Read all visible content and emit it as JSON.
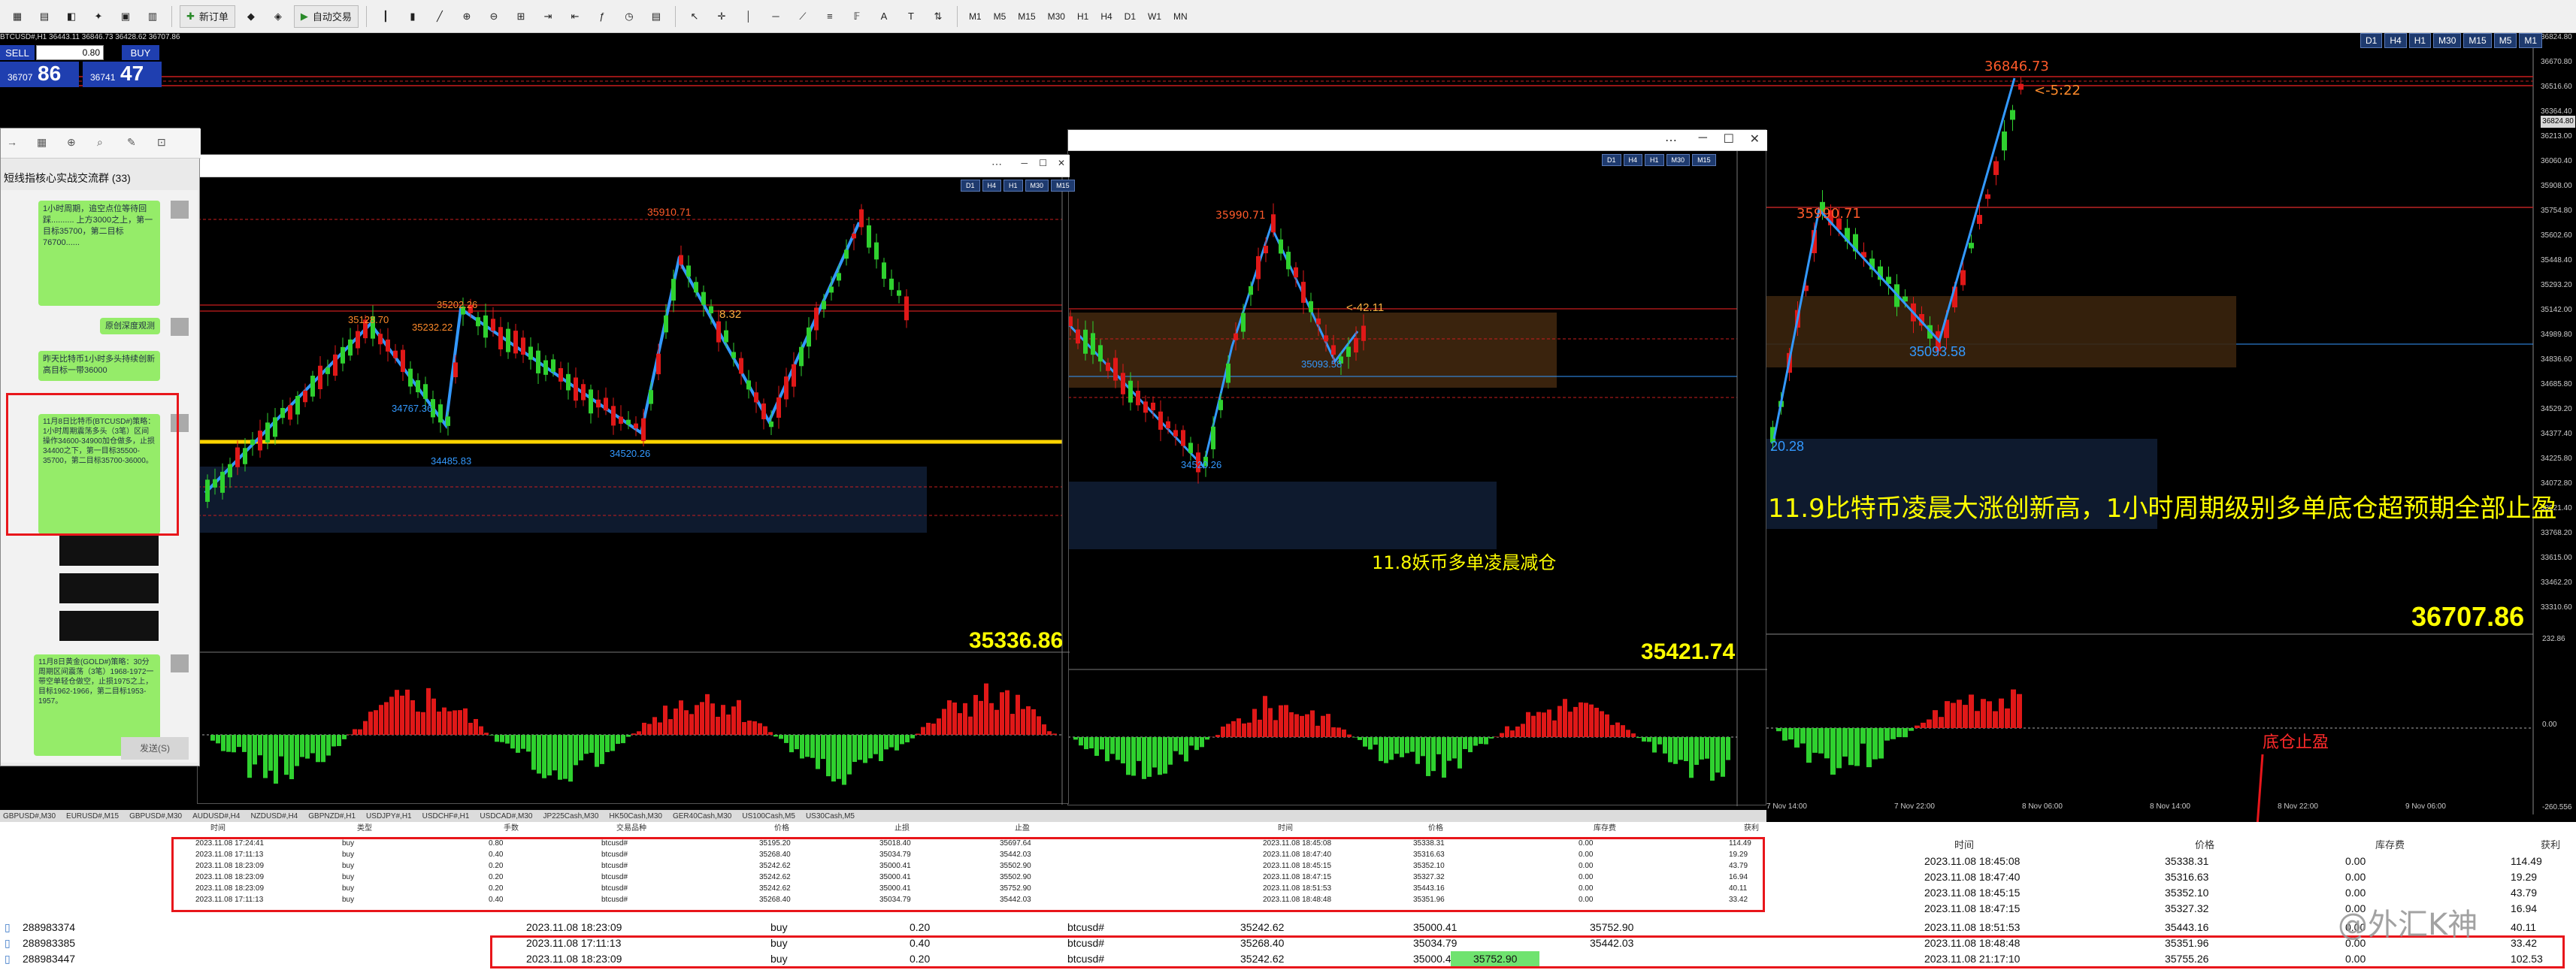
{
  "toolbar": {
    "new_order": "新订单",
    "auto_trade": "自动交易",
    "timeframes": [
      "M1",
      "M5",
      "M15",
      "M30",
      "H1",
      "H4",
      "D1",
      "W1",
      "MN"
    ]
  },
  "trade_panel": {
    "symbol_line": "BTCUSD#,H1  36443.11 36846.73 36428.62 36707.86",
    "sell": "SELL",
    "buy": "BUY",
    "lot": "0.80",
    "sell_small": "36707",
    "sell_big": "86",
    "buy_small": "36741",
    "buy_big": "47"
  },
  "chat": {
    "title": "短线指核心实战交流群 (33)",
    "msg1": "1小时周期，追空点位等待回踩.......... 上方3000之上，第一目标35700，第二目标76700......",
    "msg2": "原创深度观测",
    "msg3": "昨天比特币1小时多头持续创新高目标一带36000",
    "msg4": "11月8日比特币(BTCUSD#)策略：1小时周期震荡多头（3笔）区间操作34600-34900加仓做多，止损34400之下，第一目标35500-35700，第二目标35700-36000。",
    "msg5": "11月8日黄金(GOLD#)策略：30分周期区间震荡（3笔）1968-1972一带空单轻仓做空，止损1975之上，目标1962-1966，第二目标1953-1957。",
    "send": "发送(S)"
  },
  "main": {
    "close_price": "36707.86",
    "high_label": "36846.73",
    "high_delta": "<-5:22",
    "swing_high": "35990.71",
    "swing_low": "35093.58",
    "left_low": "20.28",
    "headline": "11.9比特币凌晨大涨创新高，1小时周期级别多单底仓超预期全部止盈",
    "bottom_label": "底仓止盈",
    "tf_buttons": [
      "D1",
      "H4",
      "H1",
      "M30",
      "M15",
      "M5",
      "M1"
    ],
    "x_ticks": [
      "7 Nov 14:00",
      "7 Nov 22:00",
      "8 Nov 06:00",
      "8 Nov 14:00",
      "8 Nov 22:00",
      "9 Nov 06:00"
    ],
    "y_ticks": [
      "36824.80",
      "36670.80",
      "36516.60",
      "36364.40",
      "36213.00",
      "36060.40",
      "35908.00",
      "35754.80",
      "35602.60",
      "35448.40",
      "35293.20",
      "35142.00",
      "34989.80",
      "34836.60",
      "34685.80",
      "34529.20",
      "34377.40",
      "34225.80",
      "34072.80",
      "33921.40",
      "33768.20",
      "33615.00",
      "33462.20",
      "33310.60"
    ],
    "ind_ticks": [
      "232.86",
      "0.00",
      "-260.556"
    ]
  },
  "win1": {
    "close_price": "35336.86",
    "peak": "35910.71",
    "delta": "8.32",
    "l1": "35128.70",
    "l2": "35232.22",
    "l3": "35202.26",
    "lowA": "34767.36",
    "lowB": "34485.83",
    "lowC": "34520.26"
  },
  "win2": {
    "close_price": "35421.74",
    "peak": "35990.71",
    "delta": "<-42.11",
    "low": "34520.26",
    "mid": "35093.58",
    "annotation": "11.8妖币多单凌晨减仓"
  },
  "tab_strip": [
    "GBPUSD#,M30",
    "EURUSD#,M15",
    "GBPUSD#,M30",
    "AUDUSD#,H4",
    "NZDUSD#,H4",
    "GBPNZD#,H1",
    "USDJPY#,H1",
    "USDCHF#,H1",
    "USDCAD#,M30",
    "JP225Cash,M30",
    "HK50Cash,M30",
    "GER40Cash,M30",
    "US100Cash,M5",
    "US30Cash,M5"
  ],
  "orders_header": [
    "时间",
    "类型",
    "手数",
    "交易品种",
    "价格",
    "止损",
    "止盈",
    "时间",
    "价格",
    "库存费",
    "获利"
  ],
  "orders_small": [
    [
      "2023.11.08 17:24:41",
      "buy",
      "0.80",
      "btcusd#",
      "35195.20",
      "35018.40",
      "35697.64",
      "2023.11.08 18:45:08",
      "35338.31",
      "0.00",
      "114.49"
    ],
    [
      "2023.11.08 17:11:13",
      "buy",
      "0.40",
      "btcusd#",
      "35268.40",
      "35034.79",
      "35442.03",
      "2023.11.08 18:47:40",
      "35316.63",
      "0.00",
      "19.29"
    ],
    [
      "2023.11.08 18:23:09",
      "buy",
      "0.20",
      "btcusd#",
      "35242.62",
      "35000.41",
      "35502.90",
      "2023.11.08 18:45:15",
      "35352.10",
      "0.00",
      "43.79"
    ],
    [
      "2023.11.08 18:23:09",
      "buy",
      "0.20",
      "btcusd#",
      "35242.62",
      "35000.41",
      "35502.90",
      "2023.11.08 18:47:15",
      "35327.32",
      "0.00",
      "16.94"
    ],
    [
      "2023.11.08 18:23:09",
      "buy",
      "0.20",
      "btcusd#",
      "35242.62",
      "35000.41",
      "35752.90",
      "2023.11.08 18:51:53",
      "35443.16",
      "0.00",
      "40.11"
    ],
    [
      "2023.11.08 17:11:13",
      "buy",
      "0.40",
      "btcusd#",
      "35268.40",
      "35034.79",
      "35442.03",
      "2023.11.08 18:48:48",
      "35351.96",
      "0.00",
      "33.42"
    ]
  ],
  "right_header": [
    "时间",
    "价格",
    "库存费",
    "获利"
  ],
  "right_rows": [
    [
      "2023.11.08 18:45:08",
      "35338.31",
      "0.00",
      "114.49"
    ],
    [
      "2023.11.08 18:47:40",
      "35316.63",
      "0.00",
      "19.29"
    ],
    [
      "2023.11.08 18:45:15",
      "35352.10",
      "0.00",
      "43.79"
    ],
    [
      "2023.11.08 18:47:15",
      "35327.32",
      "0.00",
      "16.94"
    ]
  ],
  "orders_big": [
    [
      "288983374",
      "2023.11.08 18:23:09",
      "buy",
      "0.20",
      "btcusd#",
      "35242.62",
      "35000.41",
      "35752.90",
      "2023.11.08 18:51:53",
      "35443.16",
      "0.00",
      "40.11"
    ],
    [
      "288983385",
      "2023.11.08 17:11:13",
      "buy",
      "0.40",
      "btcusd#",
      "35268.40",
      "35034.79",
      "35442.03",
      "2023.11.08 18:48:48",
      "35351.96",
      "0.00",
      "33.42"
    ],
    [
      "288983447",
      "2023.11.08 18:23:09",
      "buy",
      "0.20",
      "btcusd#",
      "35242.62",
      "35000.41",
      "35752.90",
      "2023.11.08 21:17:10",
      "35755.26",
      "0.00",
      "102.53"
    ]
  ],
  "watermark": "@外汇K神"
}
